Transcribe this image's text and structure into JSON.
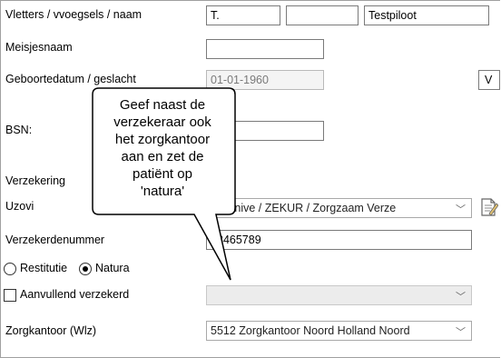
{
  "form": {
    "voorletters_label": "Vletters / vvoegsels / naam",
    "voorletters_value": "T.",
    "tussenvoegsel_value": "",
    "achternaam_value": "Testpiloot",
    "meisjesnaam_label": "Meisjesnaam",
    "meisjesnaam_value": "",
    "geboortedatum_label": "Geboortedatum / geslacht",
    "geboortedatum_value": "01-01-1960",
    "geslacht_value": "V",
    "bsn_label": "BSN:",
    "bsn_value": "",
    "verzekering_label": "Verzekering",
    "uzovi_label": "Uzovi",
    "uzovi_value": "01 Unive / ZEKUR / Zorgzaam Verze",
    "verzekerdennummer_label": "Verzekerdenummer",
    "verzekerdennummer_value": "3465789",
    "restitutie_label": "Restitutie",
    "natura_label": "Natura",
    "natura_selected": true,
    "aanvullend_label": "Aanvullend verzekerd",
    "aanvullend_checked": false,
    "aanvullend_value": "",
    "zorgkantoor_label": "Zorgkantoor (Wlz)",
    "zorgkantoor_value": "5512 Zorgkantoor Noord Holland Noord"
  },
  "tooltip": {
    "lines": [
      "Geef naast de",
      "verzekeraar ook",
      "het zorgkantoor",
      "aan en zet de",
      "patiënt op",
      "'natura'"
    ]
  },
  "icons": {
    "dropdown": "chevron-down-icon",
    "notes": "notepad-icon"
  },
  "glyphs": {
    "chevron": "﹀"
  }
}
